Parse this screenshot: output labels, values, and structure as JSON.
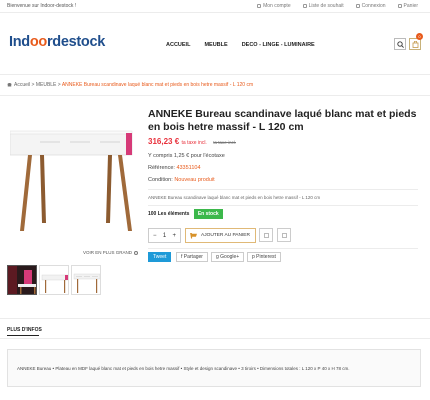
{
  "topbar": {
    "welcome": "Bienvenue sur Indoor-destock !",
    "links": [
      "Mon compte",
      "Liste de souhait",
      "Connexion",
      "Panier"
    ]
  },
  "logo": {
    "part1": "Ind",
    "part2": "oo",
    "part3": "rdestock"
  },
  "nav": [
    "ACCUEIL",
    "MEUBLE",
    "DECO - LINGE - LUMINAIRE"
  ],
  "cart": {
    "count": "0"
  },
  "breadcrumb": {
    "home": "Accueil",
    "sep": ">",
    "category": "MEUBLE",
    "current": "ANNEKE Bureau scandinave laqué blanc mat et pieds en bois hetre massif - L 120 cm"
  },
  "product": {
    "title": "ANNEKE Bureau scandinave laqué blanc mat et pieds en bois hetre massif - L 120 cm",
    "price": "316,23 €",
    "price_tax": "ta taxe incl.",
    "old_price": "ta taxe incl.",
    "ecotax": "Y compris 1,25 € pour l'écotaxe",
    "reference_label": "Référence:",
    "reference_value": "43351104",
    "condition_label": "Condition:",
    "condition_value": "Nouveau produit",
    "short_description": "ANNEKE Bureau scandinave laqué blanc mat et pieds en bois hetre massif - L 120 cm",
    "stock_label": "100 Les éléments",
    "stock_badge": "En stock",
    "quantity": "1",
    "qty_minus": "−",
    "qty_plus": "+",
    "add_to_cart": "AJOUTER AU PANIER",
    "view_larger": "VOIR EN PLUS GRAND"
  },
  "share": {
    "tweet": "Tweet",
    "facebook": "Partager",
    "google": "Google+",
    "pinterest": "Pinterest"
  },
  "tabs": {
    "more_info": "PLUS D'INFOS"
  },
  "description": "ANNEKE Bureau • Plateau en MDF laqué blanc mat et pieds en bois hetre massif • Style et design scandinave • 3 tiroirs • Dimensions totales : L 120 x P 40 x H 78 cm.",
  "colors": {
    "accent": "#e85a1b",
    "price": "#e8303b",
    "stock": "#3cb84b",
    "tweet": "#1e9ad8",
    "logo_blue": "#1f4e8c"
  }
}
